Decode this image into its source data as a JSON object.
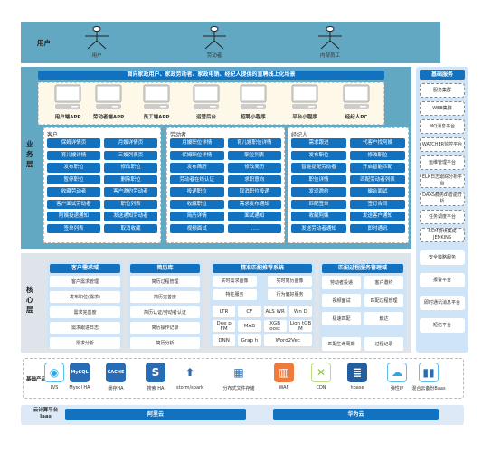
{
  "user_layer": {
    "label": "用户",
    "actors": [
      "用户",
      "劳动者",
      "内部员工"
    ]
  },
  "business_layer": {
    "label": "业务层",
    "banner": "面向家政用户、家政劳动者、家政电销、经纪人提供的直聘线上化场景",
    "devices": [
      "用户端APP",
      "劳动者端APP",
      "员工端APP",
      "运营后台",
      "招聘小程序",
      "平台小程序",
      "经纪人PC"
    ],
    "customer": {
      "title": "客户",
      "items": [
        "保姆详情页",
        "月嫂详情页",
        "育儿嫂详情",
        "三嫂列表页",
        "发布职位",
        "修改职位",
        "暂停职位",
        "删除职位",
        "收藏劳动者",
        "客户邀约劳动者",
        "客户面试劳动者",
        "职位列表",
        "阿姨投递通知",
        "发送通知劳动者",
        "签单列表",
        "取消收藏"
      ]
    },
    "worker": {
      "title": "劳动者",
      "items": [
        "月嫂职位详情",
        "育儿嫂职位详情",
        "保姆职位详情",
        "职位列表",
        "发布简历",
        "修改简历",
        "劳动者在线认证",
        "求职意向",
        "投递职位",
        "取消职位投递",
        "收藏职位",
        "需求发布通知",
        "简历详情",
        "面试通知",
        "视频面试",
        "……"
      ]
    },
    "broker": {
      "title": "经纪人",
      "items": [
        "需求跟进",
        "代客户找阿姨",
        "发布职位",
        "修改职位",
        "智能提配劳动者",
        "开启智能匹配",
        "职位详情",
        "匹配劳动者列表",
        "发送邀约",
        "撮合面试",
        "匹配签单",
        "签订合同",
        "收藏阿姨",
        "发送客户通知",
        "发送劳动者通知",
        "即时通讯"
      ]
    }
  },
  "base_services": {
    "title": "基础服务",
    "items": [
      "服务集群",
      "WEB集群",
      "MQ消息平台",
      "WATCHER监控平台",
      "运维管理平台",
      "ELK日志跟踪分析平台",
      "DAAS服务BI智能分析",
      "任务调度平台",
      "SCM持续集成JENKINS",
      "安全策略服务",
      "报警平台",
      "即时通讯消息平台",
      "短信平台"
    ]
  },
  "core_layer": {
    "label": "核心层",
    "demand": {
      "title": "客户需求域",
      "items": [
        "客户需求管理",
        "发布职位(需求)",
        "需求完善度",
        "需求跟进日志",
        "需求分析"
      ]
    },
    "resume": {
      "title": "简历库",
      "items": [
        "简历过程管理",
        "简历完善度",
        "简历认证/劳动者认证",
        "简历操作记录",
        "简历分析"
      ]
    },
    "match": {
      "title": "精准匹配推荐系统",
      "items": [
        "实时需求画像",
        "实时简历画像",
        "特征服务",
        "行为偏好服务"
      ],
      "algorithms": [
        "LTR",
        "CF",
        "ALS WR",
        "Wn D",
        "Dee p FM",
        "MAB",
        "XGB oost",
        "Ligh tGB M",
        "DNN",
        "Grap h",
        "Word2Vec"
      ]
    },
    "process": {
      "title": "匹配过程服务管理域",
      "items": [
        "劳动者投递",
        "客户邀约",
        "视频面试",
        "匹配过程管理",
        "极速匹配",
        "触达",
        "匹配生命周期",
        "过程记录"
      ]
    }
  },
  "base_products": {
    "label": "基础产品",
    "items": [
      {
        "name": "LVS",
        "icon": "lvs-icon"
      },
      {
        "name": "Mysql HA",
        "icon": "mysql-icon",
        "glyph": "MySQL"
      },
      {
        "name": "缓存HA",
        "icon": "cache-icon",
        "glyph": "CACHE"
      },
      {
        "name": "搜索 HA",
        "icon": "search-icon",
        "glyph": "S"
      },
      {
        "name": "storm/spark",
        "icon": "storm-icon"
      },
      {
        "name": "分布式文件存储",
        "icon": "storage-icon"
      },
      {
        "name": "WAF",
        "icon": "firewall-icon"
      },
      {
        "name": "CDN",
        "icon": "cdn-icon"
      },
      {
        "name": "hbase",
        "icon": "database-icon"
      },
      {
        "name": "弹性IP",
        "icon": "cloud-icon"
      },
      {
        "name": "混合云备份Baas",
        "icon": "backup-icon"
      }
    ]
  },
  "cloud": {
    "label": "云计算平台",
    "sublabel": "Iaas",
    "providers": [
      "阿里云",
      "华为云"
    ]
  },
  "colors": {
    "teal": "#62a8c3",
    "blue": "#1272bf",
    "light_blue": "#cfe4f7",
    "cream": "#fdf8e8"
  }
}
